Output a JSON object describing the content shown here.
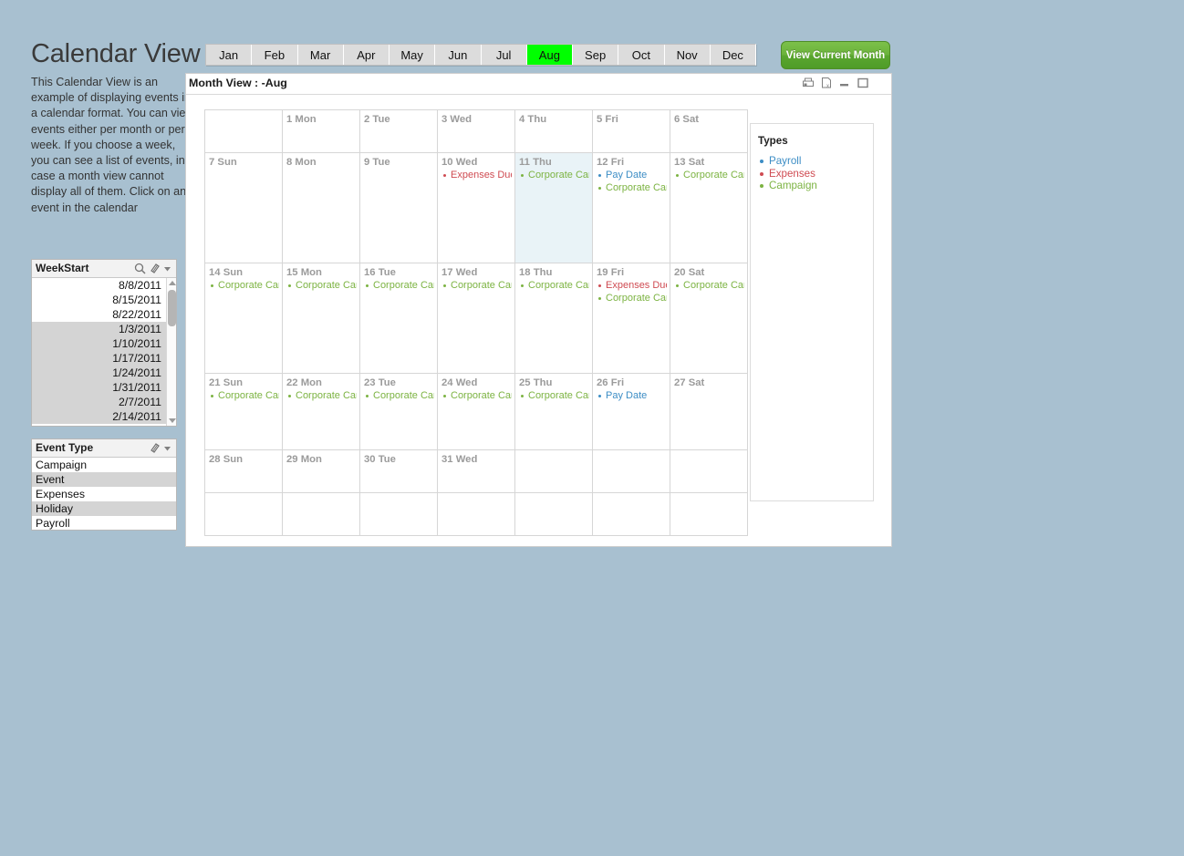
{
  "app": {
    "title": "Calendar View",
    "description": "This Calendar View is an example of displaying events in a calendar format.  You can view events either per month or per week.\nIf you choose a week, you can see a list of events, in case a month view cannot display all of them.  Click on an event in the calendar"
  },
  "month_tabs": {
    "items": [
      "Jan",
      "Feb",
      "Mar",
      "Apr",
      "May",
      "Jun",
      "Jul",
      "Aug",
      "Sep",
      "Oct",
      "Nov",
      "Dec"
    ],
    "active": "Aug",
    "active_color": "#00ff00"
  },
  "view_current_month_button": {
    "label": "View Current Month",
    "color": "#6bb33c"
  },
  "panel": {
    "title": "Month View : -Aug",
    "icons": [
      "print-icon",
      "export-excel-icon",
      "minimize-icon",
      "maximize-icon"
    ]
  },
  "filters": {
    "weekstart": {
      "title": "WeekStart",
      "icons": [
        "search-icon",
        "eraser-icon",
        "chevron-down-icon"
      ],
      "values": [
        {
          "label": "8/8/2011",
          "state": "included"
        },
        {
          "label": "8/15/2011",
          "state": "included"
        },
        {
          "label": "8/22/2011",
          "state": "included"
        },
        {
          "label": "1/3/2011",
          "state": "excluded"
        },
        {
          "label": "1/10/2011",
          "state": "excluded"
        },
        {
          "label": "1/17/2011",
          "state": "excluded"
        },
        {
          "label": "1/24/2011",
          "state": "excluded"
        },
        {
          "label": "1/31/2011",
          "state": "excluded"
        },
        {
          "label": "2/7/2011",
          "state": "excluded"
        },
        {
          "label": "2/14/2011",
          "state": "excluded"
        }
      ]
    },
    "event_type": {
      "title": "Event Type",
      "icons": [
        "eraser-icon",
        "chevron-down-icon"
      ],
      "values": [
        {
          "label": "Campaign",
          "state": "included"
        },
        {
          "label": "Event",
          "state": "excluded"
        },
        {
          "label": "Expenses",
          "state": "included"
        },
        {
          "label": "Holiday",
          "state": "excluded"
        },
        {
          "label": "Payroll",
          "state": "included"
        }
      ]
    }
  },
  "legend": {
    "title": "Types",
    "items": [
      {
        "label": "Payroll",
        "color": "#3c8dc5"
      },
      {
        "label": "Expenses",
        "color": "#cf4b52"
      },
      {
        "label": "Campaign",
        "color": "#7cb342"
      }
    ]
  },
  "calendar": {
    "month": "Aug",
    "today": "11 Thu",
    "weeks": [
      [
        {
          "day": ""
        },
        {
          "day": "1 Mon"
        },
        {
          "day": "2 Tue"
        },
        {
          "day": "3 Wed"
        },
        {
          "day": "4 Thu"
        },
        {
          "day": "5 Fri"
        },
        {
          "day": "6 Sat"
        }
      ],
      [
        {
          "day": "7 Sun"
        },
        {
          "day": "8 Mon"
        },
        {
          "day": "9 Tue"
        },
        {
          "day": "10 Wed",
          "events": [
            {
              "label": "Expenses Due",
              "type": "Expenses"
            }
          ]
        },
        {
          "day": "11 Thu",
          "today": true,
          "events": [
            {
              "label": "Corporate Campaign",
              "type": "Campaign"
            }
          ]
        },
        {
          "day": "12 Fri",
          "events": [
            {
              "label": "Pay Date",
              "type": "Payroll"
            },
            {
              "label": "Corporate Campaign",
              "type": "Campaign"
            }
          ]
        },
        {
          "day": "13 Sat",
          "events": [
            {
              "label": "Corporate Campaign",
              "type": "Campaign"
            }
          ]
        }
      ],
      [
        {
          "day": "14 Sun",
          "events": [
            {
              "label": "Corporate Campaign",
              "type": "Campaign"
            }
          ]
        },
        {
          "day": "15 Mon",
          "events": [
            {
              "label": "Corporate Campaign",
              "type": "Campaign"
            }
          ]
        },
        {
          "day": "16 Tue",
          "events": [
            {
              "label": "Corporate Campaign",
              "type": "Campaign"
            }
          ]
        },
        {
          "day": "17 Wed",
          "events": [
            {
              "label": "Corporate Campaign",
              "type": "Campaign"
            }
          ]
        },
        {
          "day": "18 Thu",
          "events": [
            {
              "label": "Corporate Campaign",
              "type": "Campaign"
            }
          ]
        },
        {
          "day": "19 Fri",
          "events": [
            {
              "label": "Expenses Due",
              "type": "Expenses"
            },
            {
              "label": "Corporate Campaign",
              "type": "Campaign"
            }
          ]
        },
        {
          "day": "20 Sat",
          "events": [
            {
              "label": "Corporate Campaign",
              "type": "Campaign"
            }
          ]
        }
      ],
      [
        {
          "day": "21 Sun",
          "events": [
            {
              "label": "Corporate Campaign",
              "type": "Campaign"
            }
          ]
        },
        {
          "day": "22 Mon",
          "events": [
            {
              "label": "Corporate Campaign",
              "type": "Campaign"
            }
          ]
        },
        {
          "day": "23 Tue",
          "events": [
            {
              "label": "Corporate Campaign",
              "type": "Campaign"
            }
          ]
        },
        {
          "day": "24 Wed",
          "events": [
            {
              "label": "Corporate Campaign",
              "type": "Campaign"
            }
          ]
        },
        {
          "day": "25 Thu",
          "events": [
            {
              "label": "Corporate Campaign",
              "type": "Campaign"
            }
          ]
        },
        {
          "day": "26 Fri",
          "events": [
            {
              "label": "Pay Date",
              "type": "Payroll"
            }
          ]
        },
        {
          "day": "27 Sat"
        }
      ],
      [
        {
          "day": "28 Sun"
        },
        {
          "day": "29 Mon"
        },
        {
          "day": "30 Tue"
        },
        {
          "day": "31 Wed"
        },
        {
          "day": ""
        },
        {
          "day": ""
        },
        {
          "day": ""
        }
      ],
      [
        {
          "day": ""
        },
        {
          "day": ""
        },
        {
          "day": ""
        },
        {
          "day": ""
        },
        {
          "day": ""
        },
        {
          "day": ""
        },
        {
          "day": ""
        }
      ]
    ]
  }
}
